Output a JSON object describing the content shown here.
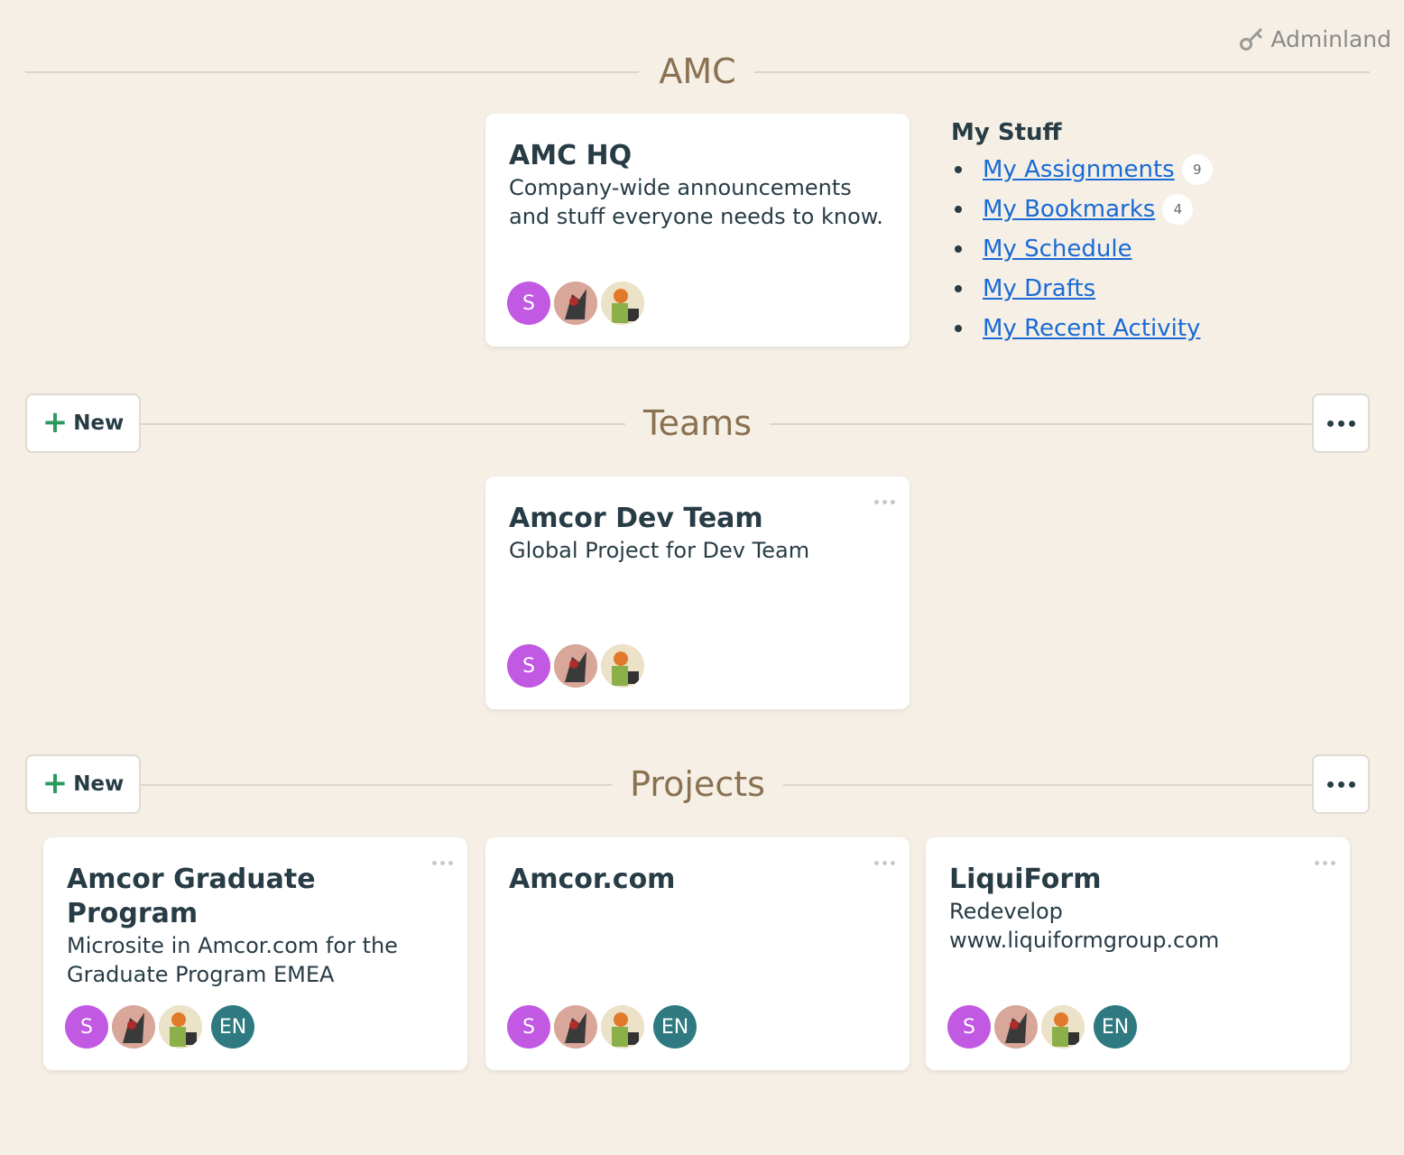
{
  "adminland": {
    "label": "Adminland",
    "icon": "key-icon"
  },
  "company": {
    "title": "AMC"
  },
  "hq": {
    "name": "AMC HQ",
    "description": "Company-wide announcements and stuff everyone needs to know.",
    "avatars": [
      "S"
    ]
  },
  "my_stuff": {
    "heading": "My Stuff",
    "items": [
      {
        "label": "My Assignments",
        "count": "9"
      },
      {
        "label": "My Bookmarks",
        "count": "4"
      },
      {
        "label": "My Schedule"
      },
      {
        "label": "My Drafts"
      },
      {
        "label": "My Recent Activity"
      }
    ]
  },
  "teams": {
    "title": "Teams",
    "new_label": "New",
    "cards": [
      {
        "name": "Amcor Dev Team",
        "description": "Global Project for Dev Team",
        "initial": "S"
      }
    ]
  },
  "projects": {
    "title": "Projects",
    "new_label": "New",
    "cards": [
      {
        "name": "Amcor Graduate Program",
        "description": "Microsite in Amcor.com for the Graduate Program EMEA",
        "initial": "S",
        "extra_initial": "EN"
      },
      {
        "name": "Amcor.com",
        "description": "",
        "initial": "S",
        "extra_initial": "EN"
      },
      {
        "name": "LiquiForm",
        "description": "Redevelop www.liquiformgroup.com",
        "initial": "S",
        "extra_initial": "EN"
      }
    ]
  },
  "colors": {
    "background": "#f5efe5",
    "section_title": "#8a7152",
    "link": "#1a6ad6",
    "plus": "#2b9a5e",
    "avatar_s": "#c159e3",
    "avatar_en": "#2e7a80"
  }
}
